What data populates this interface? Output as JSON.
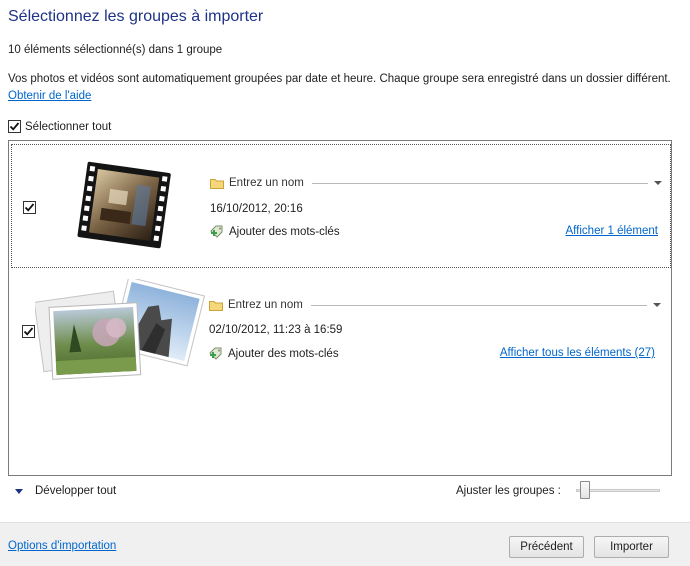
{
  "header": {
    "title": "Sélectionnez les groupes à importer",
    "selection_summary": "10 éléments sélectionné(s) dans 1 groupe",
    "description": "Vos photos et vidéos sont automatiquement groupées par date et heure. Chaque groupe sera enregistré dans un dossier différent.",
    "help_link": "Obtenir de l'aide"
  },
  "select_all": {
    "label": "Sélectionner tout",
    "checked": true
  },
  "groups": [
    {
      "checked": true,
      "name_placeholder": "Entrez un nom",
      "date": "16/10/2012, 20:16",
      "keywords_label": "Ajouter des mots-clés",
      "show_link": "Afficher 1 élément",
      "thumbnail": "video-film-icon"
    },
    {
      "checked": true,
      "name_placeholder": "Entrez un nom",
      "date": "02/10/2012, 11:23 à 16:59",
      "keywords_label": "Ajouter des mots-clés",
      "show_link": "Afficher tous les éléments (27)",
      "thumbnail": "photo-stack-icon"
    }
  ],
  "controls": {
    "expand_all": "Développer tout",
    "adjust_groups_label": "Ajuster les groupes :"
  },
  "footer": {
    "options_link": "Options d'importation",
    "previous_button": "Précédent",
    "import_button": "Importer"
  },
  "colors": {
    "title": "#1e3287",
    "link": "#0066cc",
    "footer_bg": "#f0f0f0"
  }
}
